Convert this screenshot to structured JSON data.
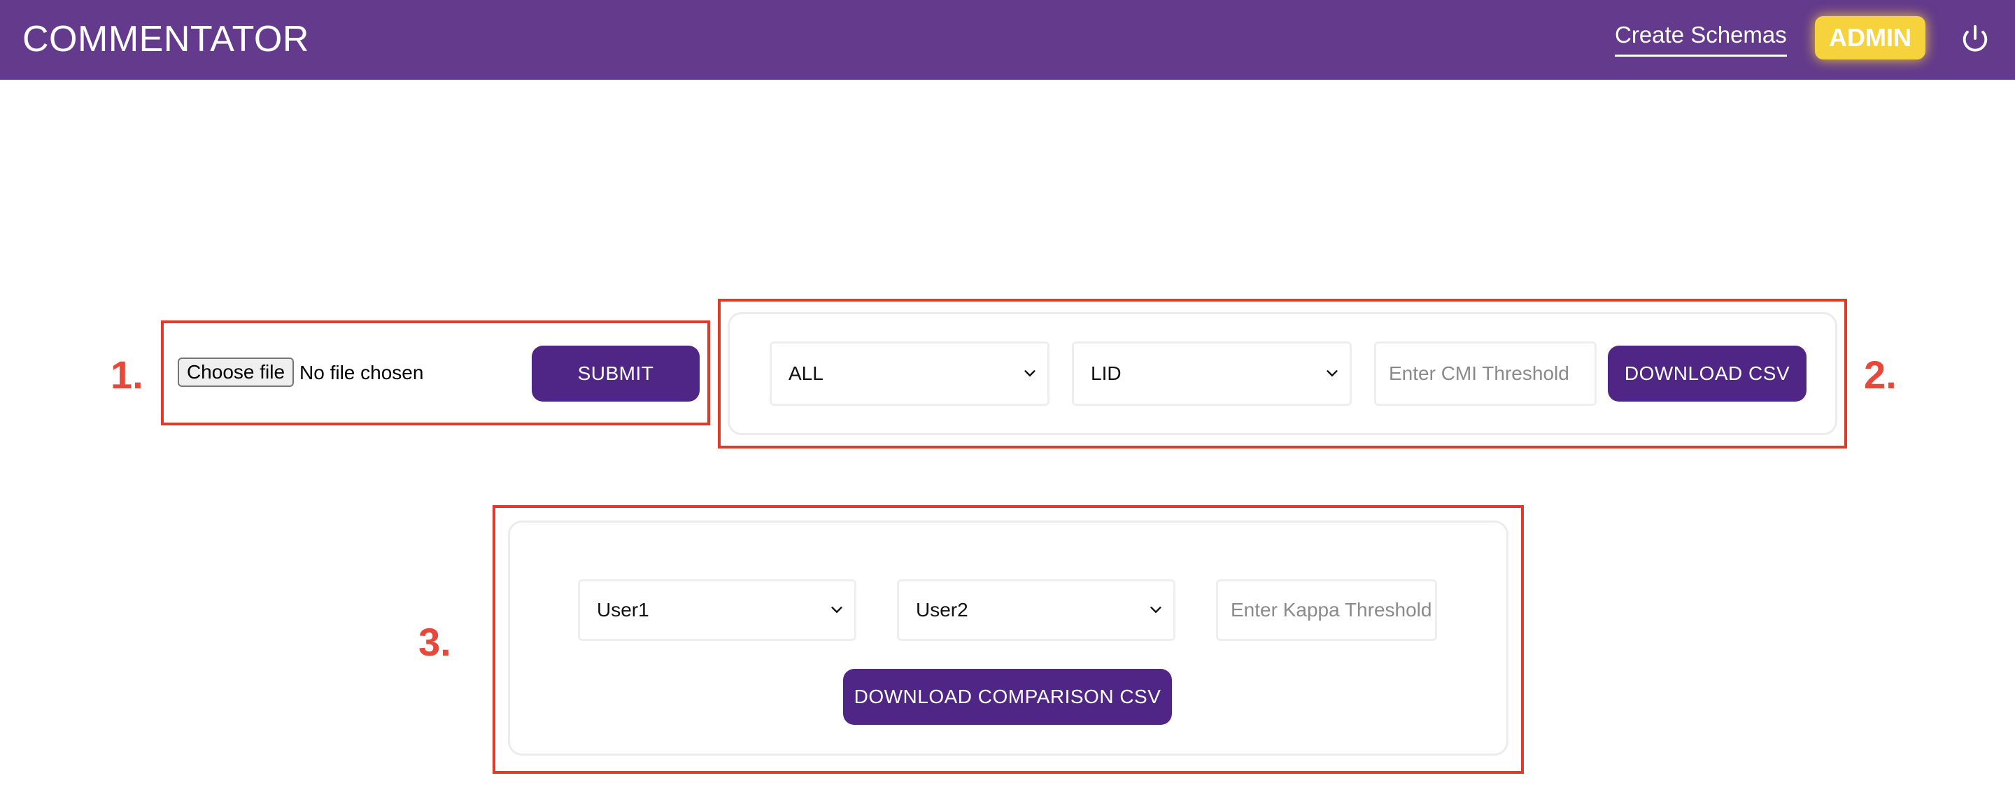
{
  "header": {
    "brand": "COMMENTATOR",
    "create_schemas_link": "Create Schemas",
    "admin_badge": "ADMIN",
    "power_icon": "power-icon"
  },
  "annotations": {
    "label_1": "1.",
    "label_2": "2.",
    "label_3": "3.",
    "color": "#e03a2a"
  },
  "upload_section": {
    "choose_file_label": "Choose file",
    "file_status": "No file chosen",
    "submit_label": "SUBMIT"
  },
  "download_section": {
    "filter_select_value": "ALL",
    "type_select_value": "LID",
    "cmi_threshold_placeholder": "Enter CMI Threshold",
    "download_label": "DOWNLOAD CSV"
  },
  "comparison_section": {
    "user1_select_value": "User1",
    "user2_select_value": "User2",
    "kappa_threshold_placeholder": "Enter Kappa Threshold",
    "download_label": "DOWNLOAD COMPARISON CSV"
  },
  "colors": {
    "header_bg": "#633a8c",
    "button_bg": "#4f2585",
    "admin_bg": "#f6d23c"
  }
}
